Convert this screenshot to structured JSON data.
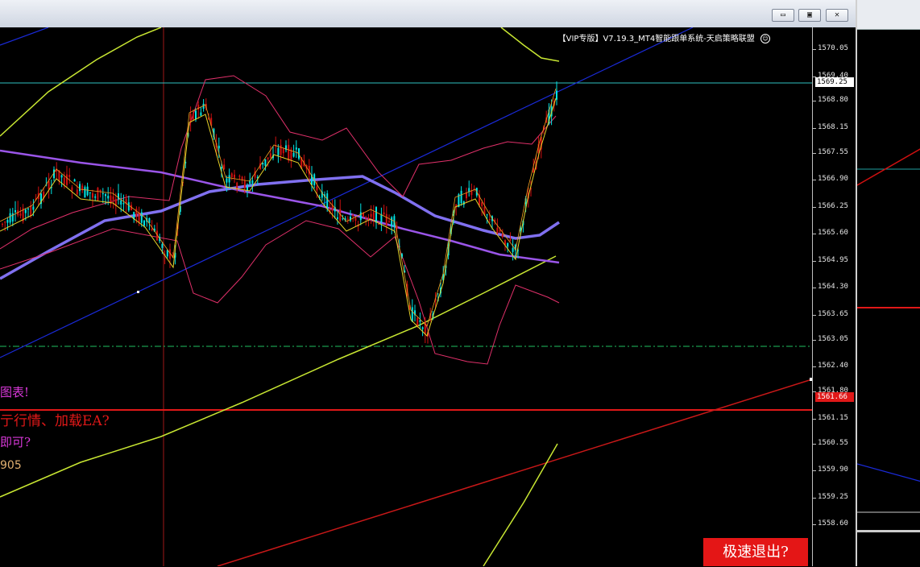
{
  "window": {
    "min_label": "▭",
    "max_label": "▣",
    "close_label": "✕"
  },
  "chart": {
    "header_text": "【VIP专版】V7.19.3_MT4智能跟单系统-天启策略联盟",
    "header_icon": "smiley-icon",
    "price_ticks": [
      "1570.05",
      "1569.40",
      "1568.80",
      "1568.15",
      "1567.55",
      "1566.90",
      "1566.25",
      "1565.60",
      "1564.95",
      "1564.30",
      "1563.65",
      "1563.05",
      "1562.40",
      "1561.80",
      "1561.15",
      "1560.55",
      "1559.90",
      "1559.25",
      "1558.60"
    ],
    "bid_price": "1569.25",
    "red_line_price": "1561.66",
    "messages": [
      {
        "text": "图表!",
        "color": "#d838d8"
      },
      {
        "text": "亍行情、加载EA?",
        "color": "#e01818"
      },
      {
        "text": "即可?",
        "color": "#d838d8"
      },
      {
        "text": "905",
        "color": "#e0b070"
      }
    ],
    "exit_button": "极速退出?",
    "colors": {
      "bull": "#00e5e5",
      "bear": "#d01010",
      "bollinger": "#e0306a",
      "ma_long": "#c8e632",
      "ma_purple": "#9a55e8",
      "ma_violet": "#8070f0",
      "channel": "#1a2ad8",
      "support": "#e01818"
    }
  }
}
